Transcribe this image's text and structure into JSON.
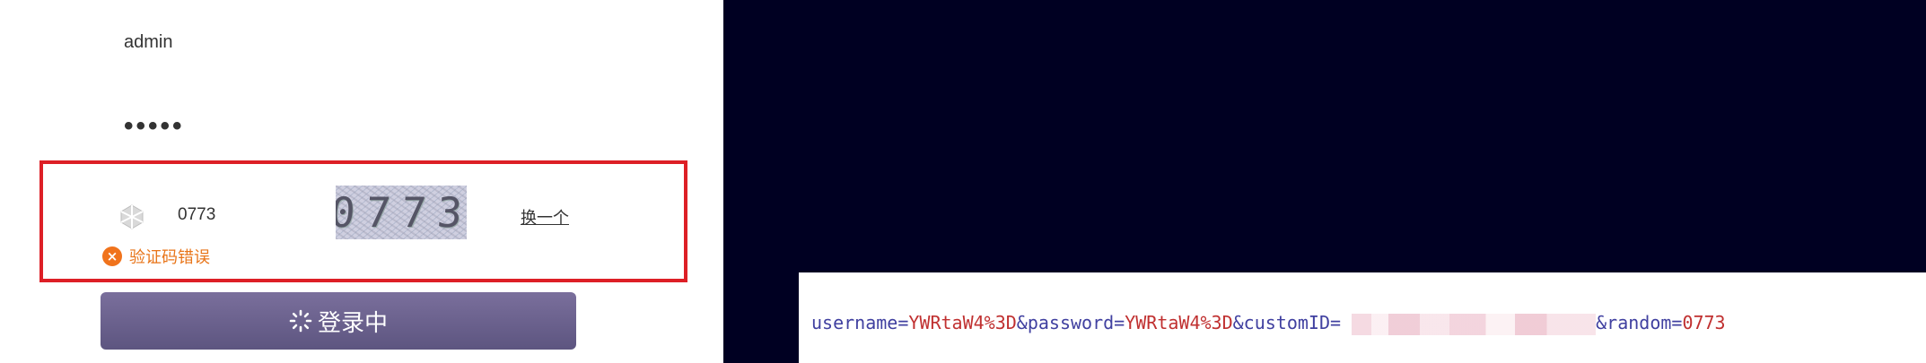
{
  "login": {
    "username_value": "admin",
    "password_value": "•••••",
    "captcha": {
      "input_value": "0773",
      "image_text": "0773",
      "refresh_label": "换一个",
      "error_message": "验证码错误",
      "highlight_color": "#dd1f26"
    },
    "login_button_label": "登录中",
    "icons": {
      "captcha": "captcha-shield-icon",
      "error": "error-x-icon",
      "button": "spinner-icon"
    },
    "colors": {
      "button": "#6b6390",
      "error": "#e8751a"
    }
  },
  "request": {
    "k_username": "username=",
    "v_username": "YWRtaW4%3D",
    "k_password": "&password=",
    "v_password": "YWRtaW4%3D",
    "k_custom": "&customID=",
    "k_random": "&random=",
    "v_random": "0773"
  }
}
